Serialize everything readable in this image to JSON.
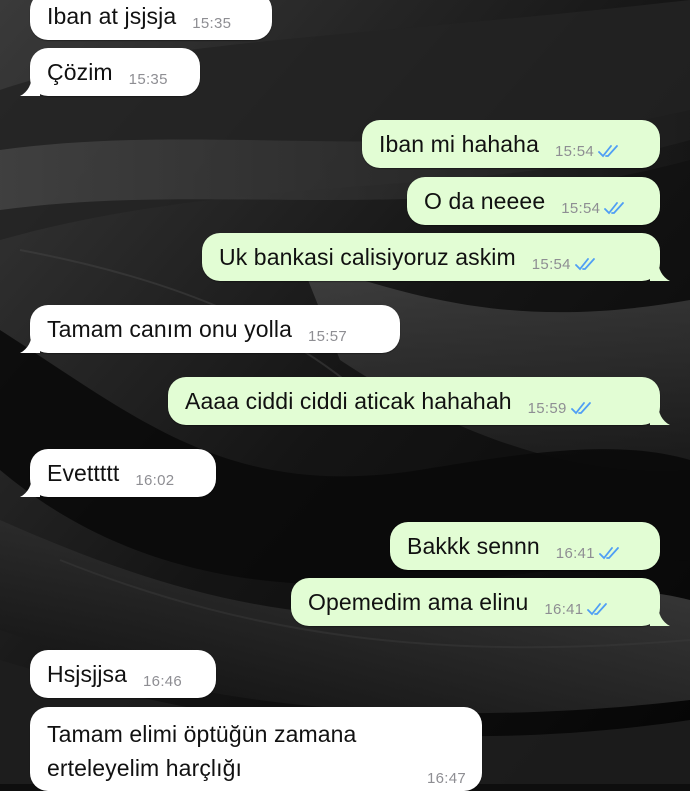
{
  "messages": [
    {
      "text": "Iban at jsjsja",
      "time": "15:35",
      "direction": "in"
    },
    {
      "text": "Çözim",
      "time": "15:35",
      "direction": "in"
    },
    {
      "text": "Iban mi hahaha",
      "time": "15:54",
      "direction": "out",
      "status": "read"
    },
    {
      "text": "O da neeee",
      "time": "15:54",
      "direction": "out",
      "status": "read"
    },
    {
      "text": "Uk bankasi calisiyoruz askim",
      "time": "15:54",
      "direction": "out",
      "status": "read"
    },
    {
      "text": "Tamam canım onu yolla",
      "time": "15:57",
      "direction": "in"
    },
    {
      "text": "Aaaa ciddi ciddi aticak hahahah",
      "time": "15:59",
      "direction": "out",
      "status": "read"
    },
    {
      "text": "Evettttt",
      "time": "16:02",
      "direction": "in"
    },
    {
      "text": "Bakkk sennn",
      "time": "16:41",
      "direction": "out",
      "status": "read"
    },
    {
      "text": "Opemedim ama elinu",
      "time": "16:41",
      "direction": "out",
      "status": "read"
    },
    {
      "text": "Hsjsjjsa",
      "time": "16:46",
      "direction": "in"
    },
    {
      "text": "Tamam elimi öptüğün zamana erteleyelim harçlığı",
      "time": "16:47",
      "direction": "in"
    }
  ],
  "colors": {
    "incoming_bubble": "#ffffff",
    "outgoing_bubble": "#e2fdd4",
    "read_ticks": "#4f9ef5",
    "timestamp": "#8e8e93",
    "wallpaper": "#141414"
  },
  "icons": {
    "read_receipt": "double-check-icon"
  }
}
